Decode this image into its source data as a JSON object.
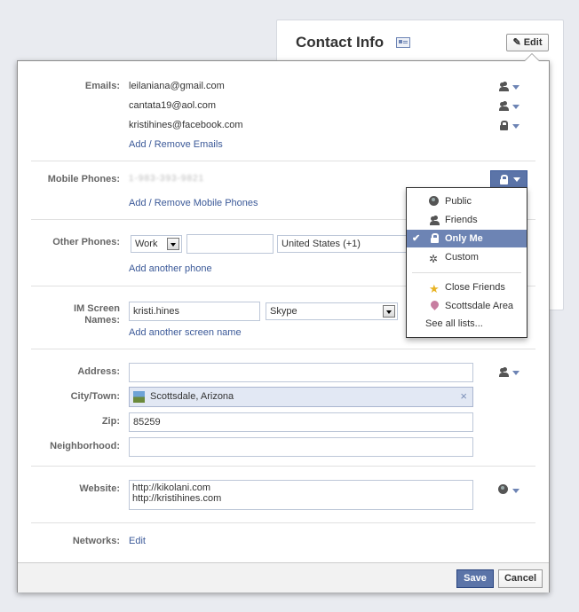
{
  "background_card": {
    "title": "Contact Info",
    "edit_label": "Edit"
  },
  "emails": {
    "label": "Emails:",
    "items": [
      {
        "address": "leilaniana@gmail.com",
        "privacy": "friends"
      },
      {
        "address": "cantata19@aol.com",
        "privacy": "friends"
      },
      {
        "address": "kristihines@facebook.com",
        "privacy": "only-me"
      }
    ],
    "manage_link": "Add / Remove Emails"
  },
  "mobile": {
    "label": "Mobile Phones:",
    "number_blurred": "1-983-393-9821",
    "manage_link": "Add / Remove Mobile Phones"
  },
  "other_phones": {
    "label": "Other Phones:",
    "type_value": "Work",
    "number_value": "",
    "country_value": "United States (+1)",
    "add_link": "Add another phone"
  },
  "im": {
    "label_line1": "IM Screen",
    "label_line2": "Names:",
    "name_value": "kristi.hines",
    "service_value": "Skype",
    "add_link": "Add another screen name"
  },
  "address": {
    "label": "Address:",
    "value": ""
  },
  "city": {
    "label": "City/Town:",
    "value": "Scottsdale, Arizona",
    "remove_glyph": "×"
  },
  "zip": {
    "label": "Zip:",
    "value": "85259"
  },
  "neighborhood": {
    "label": "Neighborhood:",
    "value": ""
  },
  "website": {
    "label": "Website:",
    "line1": "http://kikolani.com",
    "line2": "http://kristihines.com"
  },
  "networks": {
    "label": "Networks:",
    "edit_link": "Edit"
  },
  "footer": {
    "save_label": "Save",
    "cancel_label": "Cancel"
  },
  "privacy_menu": {
    "items": [
      {
        "label": "Public",
        "icon": "globe-icon"
      },
      {
        "label": "Friends",
        "icon": "friends-icon"
      },
      {
        "label": "Only Me",
        "icon": "lock-icon",
        "selected": true
      },
      {
        "label": "Custom",
        "icon": "gear-icon"
      },
      {
        "label": "Close Friends",
        "icon": "star-icon"
      },
      {
        "label": "Scottsdale Area",
        "icon": "location-icon"
      }
    ],
    "see_all": "See all lists...",
    "check_glyph": "✔"
  },
  "colors": {
    "link": "#3b5998",
    "button_blue": "#5b74a8",
    "menu_selected": "#6d84b4"
  }
}
